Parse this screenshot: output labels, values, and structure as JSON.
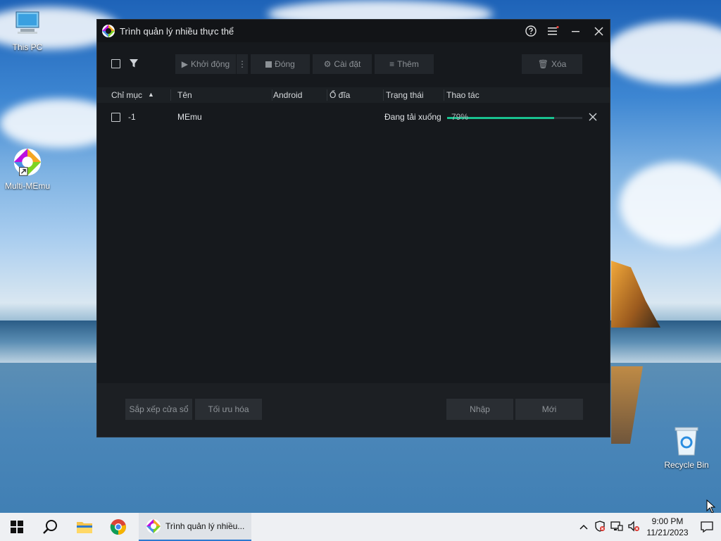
{
  "desktop": {
    "icons": [
      {
        "label": "This PC"
      },
      {
        "label": "Multi-MEmu"
      },
      {
        "label": "Recycle Bin"
      }
    ]
  },
  "window": {
    "title": "Trình quản lý nhiều thực thể",
    "toolbar": {
      "start_label": "Khởi động",
      "close_label": "Đóng",
      "settings_label": "Cài đặt",
      "more_label": "Thêm",
      "delete_label": "Xóa"
    },
    "columns": [
      "Chỉ mục",
      "Tên",
      "Android",
      "Ổ đĩa",
      "Trạng thái",
      "Thao tác"
    ],
    "rows": [
      {
        "index": "-1",
        "name": "MEmu",
        "android": "",
        "disk": "",
        "status": "Đang tải xuống",
        "progress_label": "79%",
        "progress": 0.79
      }
    ],
    "footer": {
      "arrange_label": "Sắp xếp cửa sổ",
      "optimize_label": "Tối ưu hóa",
      "import_label": "Nhập",
      "new_label": "Mới"
    }
  },
  "taskbar": {
    "active_app_label": "Trình quản lý nhiều...",
    "time": "9:00 PM",
    "date": "11/21/2023"
  },
  "colors": {
    "accent": "#19c18f",
    "window_bg": "#16191d",
    "taskbar_bg": "#eef0f3"
  }
}
